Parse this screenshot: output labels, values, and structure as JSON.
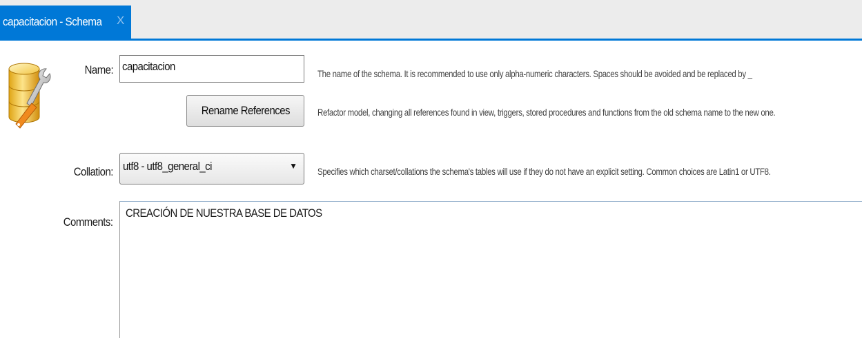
{
  "tab": {
    "title": "capacitacion - Schema",
    "close": "X"
  },
  "accent_color": "#0078d7",
  "icon": {
    "name": "database-wrench-icon"
  },
  "name_row": {
    "label": "Name:",
    "value": "capacitacion",
    "hint": "The name of the schema. It is recommended to use only alpha-numeric characters. Spaces should be avoided and be replaced by _"
  },
  "rename_row": {
    "button_label": "Rename References",
    "hint": "Refactor model, changing all references found in view, triggers, stored procedures and functions from the old schema name to the new one."
  },
  "collation_row": {
    "label": "Collation:",
    "selected": "utf8 - utf8_general_ci",
    "hint": "Specifies which charset/collations the schema's tables will use if they do not have an explicit setting. Common choices are Latin1 or UTF8."
  },
  "comments_row": {
    "label": "Comments:",
    "value": "CREACIÓN DE NUESTRA BASE DE DATOS"
  }
}
